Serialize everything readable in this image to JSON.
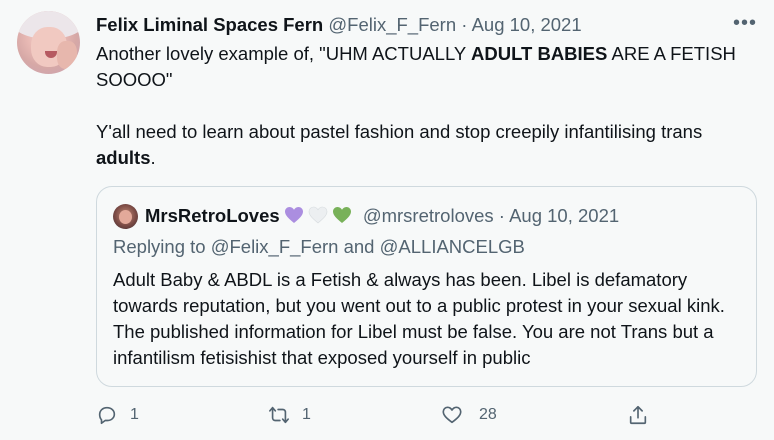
{
  "tweet": {
    "author_name": "Felix Liminal Spaces Fern",
    "handle": "@Felix_F_Fern",
    "separator": " · ",
    "date": "Aug 10, 2021",
    "more_label": "•••",
    "text": {
      "line1_a": "Another lovely example of, \"UHM ACTUALLY ",
      "line1_bold": "ADULT BABIES",
      "line1_b": " ARE A FETISH SOOOO\"",
      "line2_a": "Y'all need to learn about pastel fashion and stop creepily infantilising trans ",
      "line2_bold": "adults",
      "line2_b": "."
    }
  },
  "quote": {
    "author_name": "MrsRetroLoves",
    "hearts": [
      "purple",
      "white",
      "green"
    ],
    "heart_colors": {
      "purple": "#ab8ee0",
      "white": "#eceff1",
      "green": "#78b159"
    },
    "handle": "@mrsretroloves",
    "separator": " · ",
    "date": "Aug 10, 2021",
    "replying_label": "Replying to ",
    "reply_user1": "@Felix_F_Fern",
    "reply_and": " and ",
    "reply_user2": "@ALLIANCELGB",
    "text": "Adult Baby & ABDL is a Fetish & always has been. Libel is defamatory towards reputation, but you went out to a public protest in your sexual kink. The published information for Libel must be false. You are not Trans but a infantilism fetisishist that exposed yourself in public"
  },
  "actions": {
    "reply_icon": "reply-icon",
    "reply_count": "1",
    "retweet_icon": "retweet-icon",
    "retweet_count": "1",
    "like_icon": "heart-icon",
    "like_count": "28",
    "share_icon": "share-icon"
  },
  "colors": {
    "background": "#f7f9f9",
    "text": "#0f1419",
    "muted": "#536471",
    "border": "#cfd9de"
  }
}
